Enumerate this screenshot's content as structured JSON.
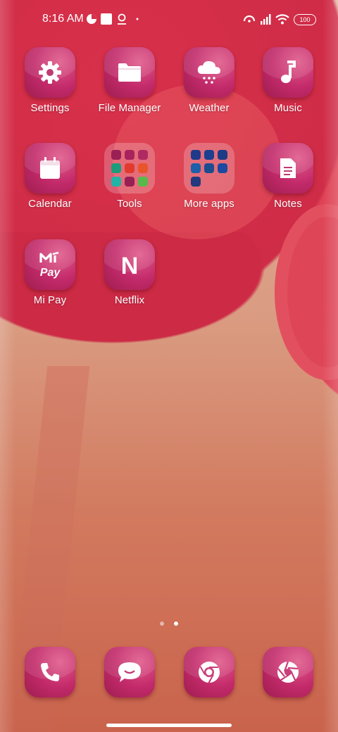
{
  "status_bar": {
    "time": "8:16 AM",
    "battery": "100"
  },
  "apps": [
    {
      "id": "settings",
      "label": "Settings",
      "icon": "gear-icon"
    },
    {
      "id": "file-manager",
      "label": "File Manager",
      "icon": "folder-icon"
    },
    {
      "id": "weather",
      "label": "Weather",
      "icon": "cloud-snow-icon"
    },
    {
      "id": "music",
      "label": "Music",
      "icon": "music-note-icon"
    },
    {
      "id": "calendar",
      "label": "Calendar",
      "icon": "calendar-icon"
    },
    {
      "id": "tools",
      "label": "Tools",
      "icon": "folder-grid-icon"
    },
    {
      "id": "more-apps",
      "label": "More apps",
      "icon": "folder-grid-icon"
    },
    {
      "id": "notes",
      "label": "Notes",
      "icon": "document-icon"
    },
    {
      "id": "mi-pay",
      "label": "Mi Pay",
      "icon": "mi-pay-icon",
      "logo_text": "Pay"
    },
    {
      "id": "netflix",
      "label": "Netflix",
      "icon": "netflix-n-icon",
      "logo_text": "N"
    }
  ],
  "dock": [
    {
      "id": "phone",
      "icon": "phone-icon"
    },
    {
      "id": "messages",
      "icon": "chat-bubble-icon"
    },
    {
      "id": "chrome",
      "icon": "chrome-icon"
    },
    {
      "id": "camera",
      "icon": "camera-aperture-icon"
    }
  ],
  "pages": {
    "count": 2,
    "active_index": 1
  },
  "colors": {
    "wallpaper_red": "#cf2c47",
    "icon_magenta": "#c32a6a",
    "text": "#ffffff"
  }
}
